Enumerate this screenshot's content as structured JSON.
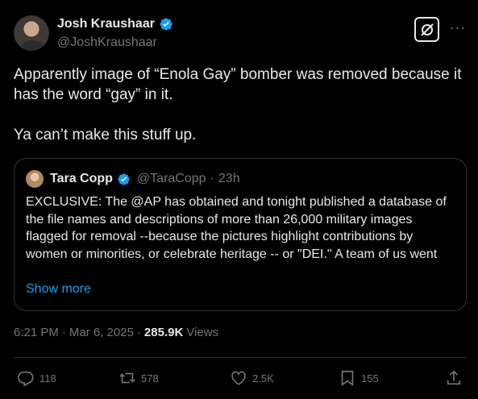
{
  "author": {
    "display_name": "Josh Kraushaar",
    "handle": "@JoshKraushaar"
  },
  "tweet": {
    "text": "Apparently image of “Enola Gay” bomber was removed because it has the word “gay” in it.\n\nYa can’t make this stuff up."
  },
  "quoted": {
    "display_name": "Tara Copp",
    "handle": "@TaraCopp",
    "separator": "·",
    "time": "23h",
    "text": "EXCLUSIVE: The @AP  has obtained and tonight published a database of the file names and descriptions of more than 26,000 military images flagged for removal --because the pictures highlight contributions by women or minorities, or celebrate heritage -- or \"DEI.\" A team of us went",
    "show_more": "Show more"
  },
  "meta": {
    "time": "6:21 PM",
    "dot": "·",
    "date": "Mar 6, 2025",
    "dot2": "·",
    "views_count": "285.9K",
    "views_label": "Views"
  },
  "actions": {
    "replies": "118",
    "reposts": "578",
    "likes": "2.5K",
    "bookmarks": "155"
  },
  "icons": {
    "verified": "verified-badge-icon",
    "grok": "grok-icon",
    "more": "more-icon",
    "reply": "reply-icon",
    "repost": "repost-icon",
    "like": "heart-icon",
    "bookmark": "bookmark-icon",
    "share": "share-icon"
  },
  "colors": {
    "background": "#000000",
    "text": "#e7e9ea",
    "muted": "#71767b",
    "accent": "#1d9bf0",
    "border": "#2f3336"
  }
}
